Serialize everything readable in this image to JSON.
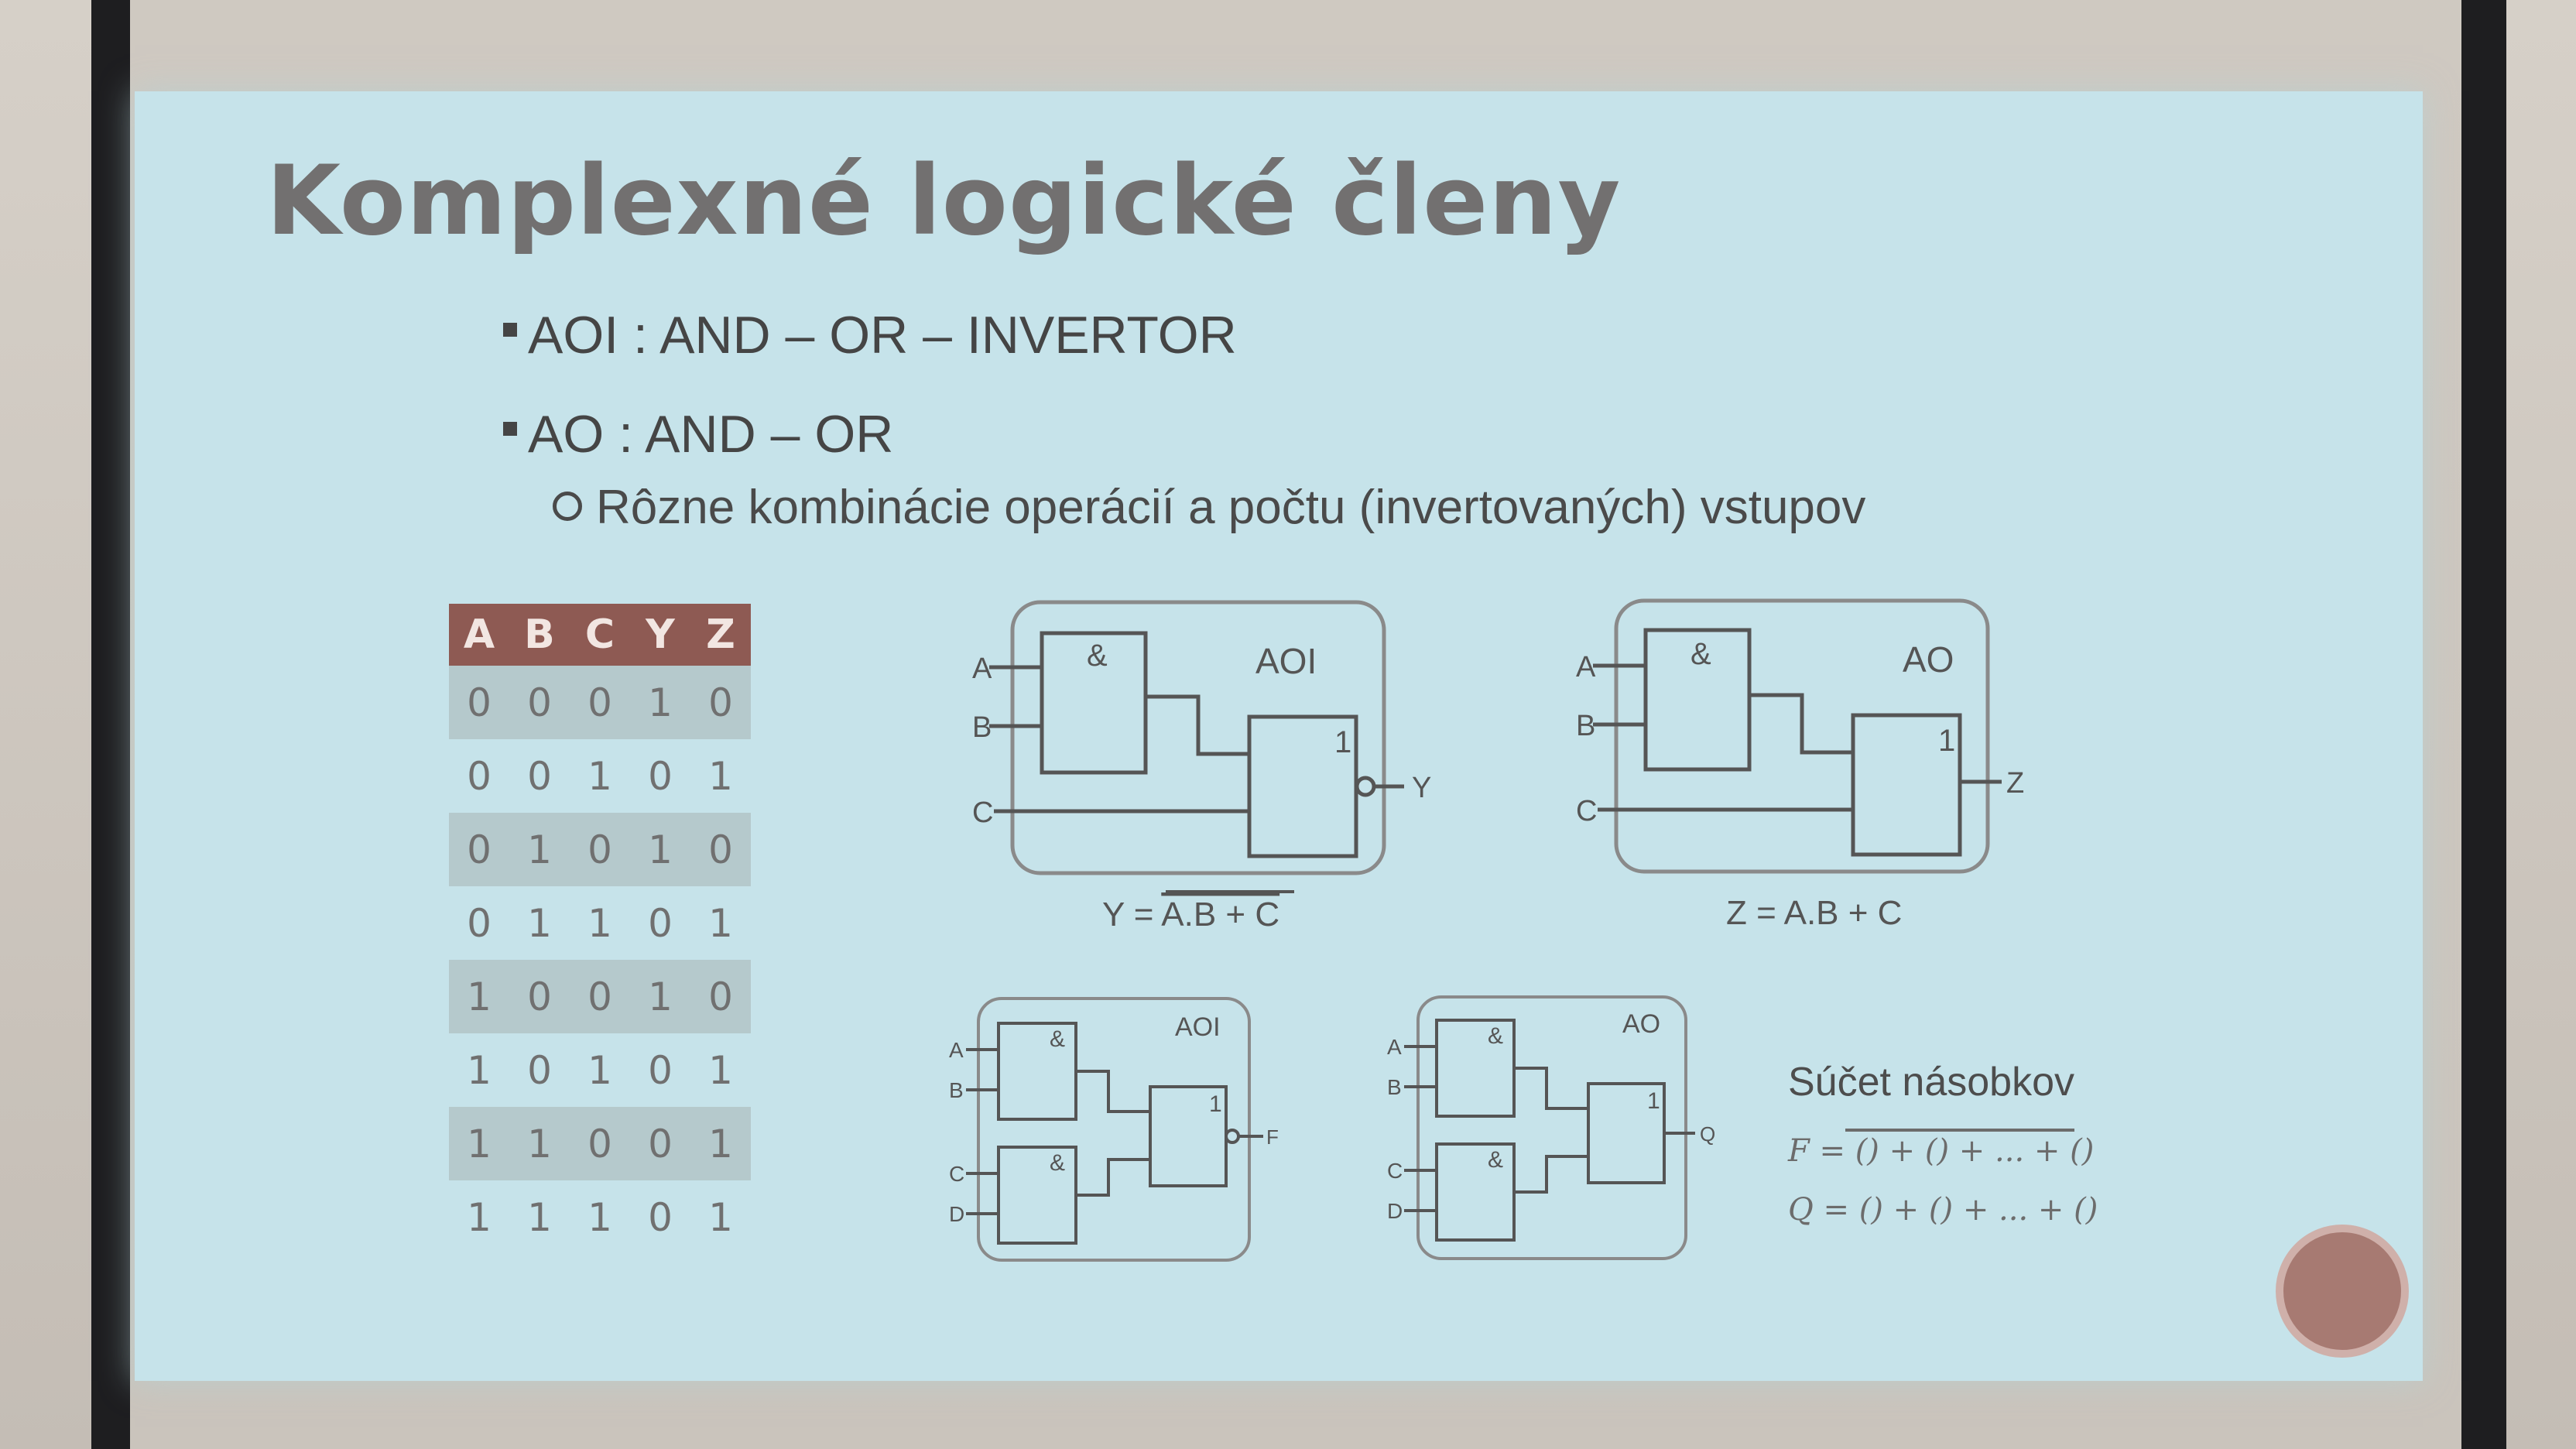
{
  "slide": {
    "title": "Komplexné logické členy",
    "bullets": [
      "AOI : AND – OR – INVERTOR",
      "AO : AND – OR"
    ],
    "sub_bullet": "Rôzne kombinácie operácií a počtu (invertovaných) vstupov"
  },
  "truth_table": {
    "headers": [
      "A",
      "B",
      "C",
      "Y",
      "Z"
    ],
    "rows": [
      [
        "0",
        "0",
        "0",
        "1",
        "0"
      ],
      [
        "0",
        "0",
        "1",
        "0",
        "1"
      ],
      [
        "0",
        "1",
        "0",
        "1",
        "0"
      ],
      [
        "0",
        "1",
        "1",
        "0",
        "1"
      ],
      [
        "1",
        "0",
        "0",
        "1",
        "0"
      ],
      [
        "1",
        "0",
        "1",
        "0",
        "1"
      ],
      [
        "1",
        "1",
        "0",
        "0",
        "1"
      ],
      [
        "1",
        "1",
        "1",
        "0",
        "1"
      ]
    ],
    "header_color": "#8e5a53"
  },
  "diagram_aoi": {
    "label": "AOI",
    "inputs": [
      "A",
      "B",
      "C"
    ],
    "and_symbol": "&",
    "or_symbol": "1",
    "output": "Y",
    "equation_lhs": "Y = ",
    "equation_rhs": "A.B + C"
  },
  "diagram_ao": {
    "label": "AO",
    "inputs": [
      "A",
      "B",
      "C"
    ],
    "and_symbol": "&",
    "or_symbol": "1",
    "output": "Z",
    "equation": "Z = A.B + C"
  },
  "diagram_aoi_small": {
    "label": "AOI",
    "inputs": [
      "A",
      "B",
      "C",
      "D"
    ],
    "and_symbol": "&",
    "or_symbol": "1",
    "output": "F"
  },
  "diagram_ao_small": {
    "label": "AO",
    "inputs": [
      "A",
      "B",
      "C",
      "D"
    ],
    "and_symbol": "&",
    "or_symbol": "1",
    "output": "Q"
  },
  "sum_of_products": {
    "label": "Súčet násobkov",
    "formula_f_lhs": "F = ",
    "formula_f_rhs": "() + () + ... + ()",
    "formula_q": "Q = () + () + ... + ()"
  }
}
